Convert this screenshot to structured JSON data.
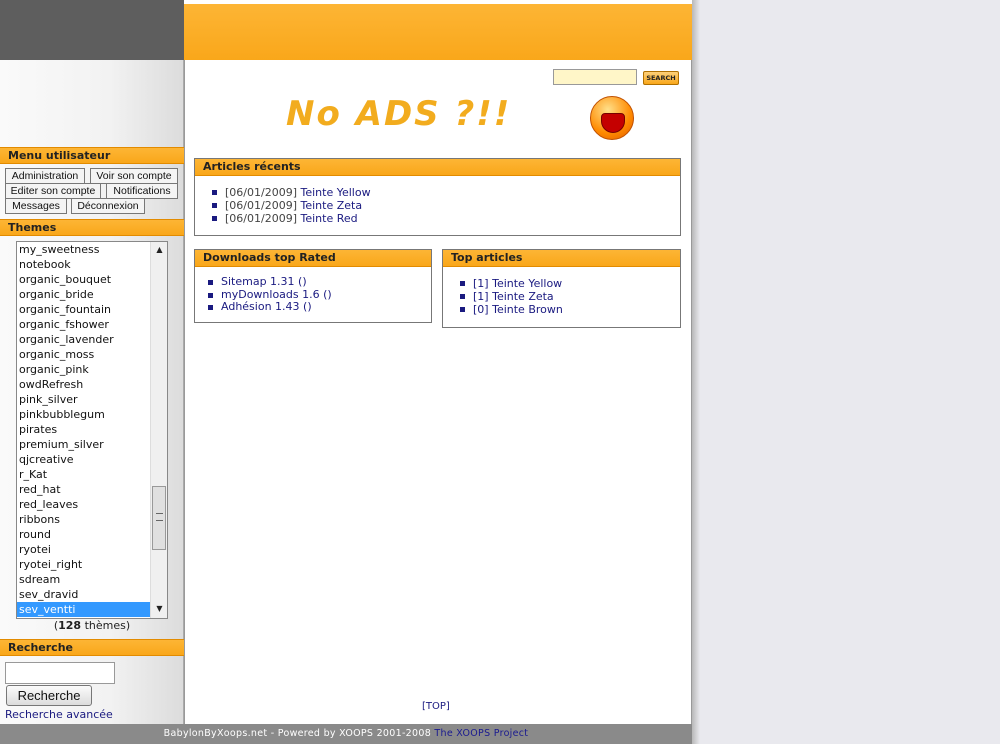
{
  "search": {
    "placeholder": "",
    "button_label": "SEARCH"
  },
  "banner": {
    "text": "No ADS ?!!"
  },
  "user_menu": {
    "title": "Menu utilisateur",
    "items": [
      "Administration",
      "Voir son compte",
      "Editer son compte",
      "Notifications",
      "Messages",
      "Déconnexion"
    ]
  },
  "themes": {
    "title": "Themes",
    "options": [
      "my_sweetness",
      "notebook",
      "organic_bouquet",
      "organic_bride",
      "organic_fountain",
      "organic_fshower",
      "organic_lavender",
      "organic_moss",
      "organic_pink",
      "owdRefresh",
      "pink_silver",
      "pinkbubblegum",
      "pirates",
      "premium_silver",
      "qjcreative",
      "r_Kat",
      "red_hat",
      "red_leaves",
      "ribbons",
      "round",
      "ryotei",
      "ryotei_right",
      "sdream",
      "sev_dravid",
      "sev_ventti"
    ],
    "selected": "sev_ventti",
    "count": "128",
    "count_suffix": "thèmes"
  },
  "recherche": {
    "title": "Recherche",
    "button_label": "Recherche",
    "advanced_label": "Recherche avancée"
  },
  "articles_recents": {
    "title": "Articles récents",
    "items": [
      {
        "date": "[06/01/2009]",
        "label": "Teinte Yellow"
      },
      {
        "date": "[06/01/2009]",
        "label": "Teinte Zeta"
      },
      {
        "date": "[06/01/2009]",
        "label": "Teinte Red"
      }
    ]
  },
  "downloads": {
    "title": "Downloads top Rated",
    "items": [
      "Sitemap 1.31 ()",
      "myDownloads 1.6 ()",
      "Adhésion 1.43 ()"
    ]
  },
  "top_articles": {
    "title": "Top articles",
    "items": [
      {
        "count": "[1]",
        "label": "Teinte Yellow"
      },
      {
        "count": "[1]",
        "label": "Teinte Zeta"
      },
      {
        "count": "[0]",
        "label": "Teinte Brown"
      }
    ]
  },
  "top_link": "[TOP]",
  "footer": {
    "text": "BabylonByXoops.net - Powered by XOOPS 2001-2008",
    "link": "The XOOPS Project"
  },
  "colors": {
    "accent": "#f9a71a",
    "link": "#1a1a80",
    "selected": "#3399ff"
  }
}
